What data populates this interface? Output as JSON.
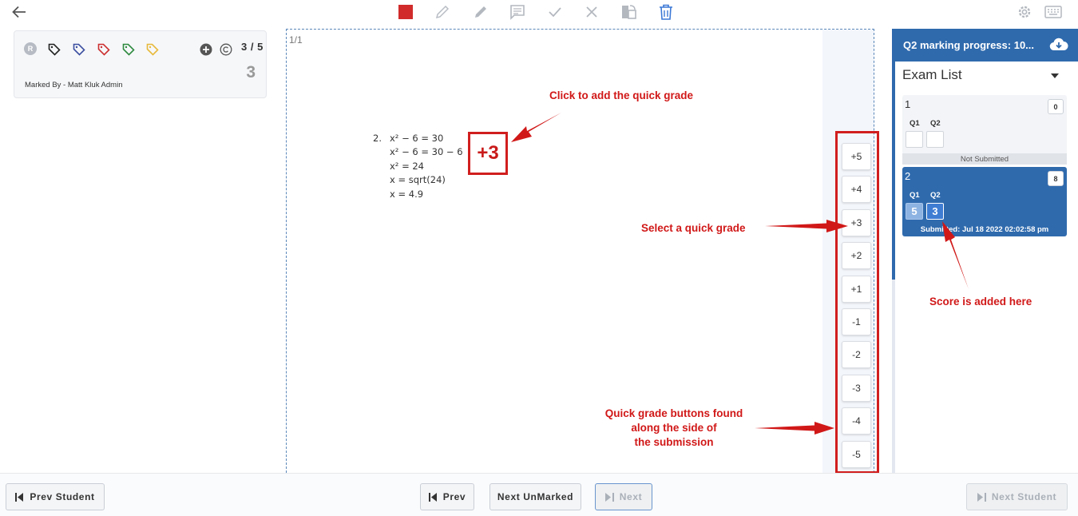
{
  "toolbar": {
    "back_icon": "arrow-left-icon",
    "tools": [
      "square-icon",
      "pencil-icon",
      "highlighter-icon",
      "comment-icon",
      "check-icon",
      "cross-icon",
      "rotate-icon",
      "trash-icon"
    ],
    "right_tools": [
      "gear-icon",
      "keyboard-icon"
    ]
  },
  "info_card": {
    "badge": "R",
    "score_fraction": "3 / 5",
    "score": "3",
    "marked_by": "Marked By - Matt Kluk Admin",
    "tag_colors": [
      "#222222",
      "#3b4fa0",
      "#cc2f2f",
      "#2d8a3e",
      "#e7b93a"
    ]
  },
  "submission": {
    "page_indicator": "1/1",
    "question_number": "2.",
    "answer_lines": [
      "x² − 6 = 30",
      "x² − 6 = 30 − 6",
      "x² = 24",
      "x = sqrt(24)",
      "x = 4.9"
    ],
    "applied_grade": "+3"
  },
  "quick_grades": [
    "+5",
    "+4",
    "+3",
    "+2",
    "+1",
    "-1",
    "-2",
    "-3",
    "-4",
    "-5"
  ],
  "right_panel": {
    "progress_title": "Q2 marking progress: 10...",
    "exam_list_title": "Exam List",
    "exams": [
      {
        "number": "1",
        "total": "0",
        "q_labels": [
          "Q1",
          "Q2"
        ],
        "q_scores": [
          "",
          ""
        ],
        "status": "Not Submitted"
      },
      {
        "number": "2",
        "total": "8",
        "q_labels": [
          "Q1",
          "Q2"
        ],
        "q_scores": [
          "5",
          "3"
        ],
        "status": "Submitted: Jul 18 2022 02:02:58 pm"
      }
    ]
  },
  "annotations": {
    "click_add": "Click to add the quick grade",
    "select_grade": "Select a quick grade",
    "score_added": "Score is added here",
    "buttons_found": [
      "Quick grade buttons found",
      "along the side of",
      "the submission"
    ]
  },
  "nav": {
    "prev_student": "Prev Student",
    "prev": "Prev",
    "next_unmarked": "Next UnMarked",
    "next": "Next",
    "next_student": "Next Student"
  },
  "colors": {
    "accent": "#2f6aad",
    "annotation": "#d11818",
    "stop": "#d12b2b",
    "trash": "#3b78d6"
  }
}
